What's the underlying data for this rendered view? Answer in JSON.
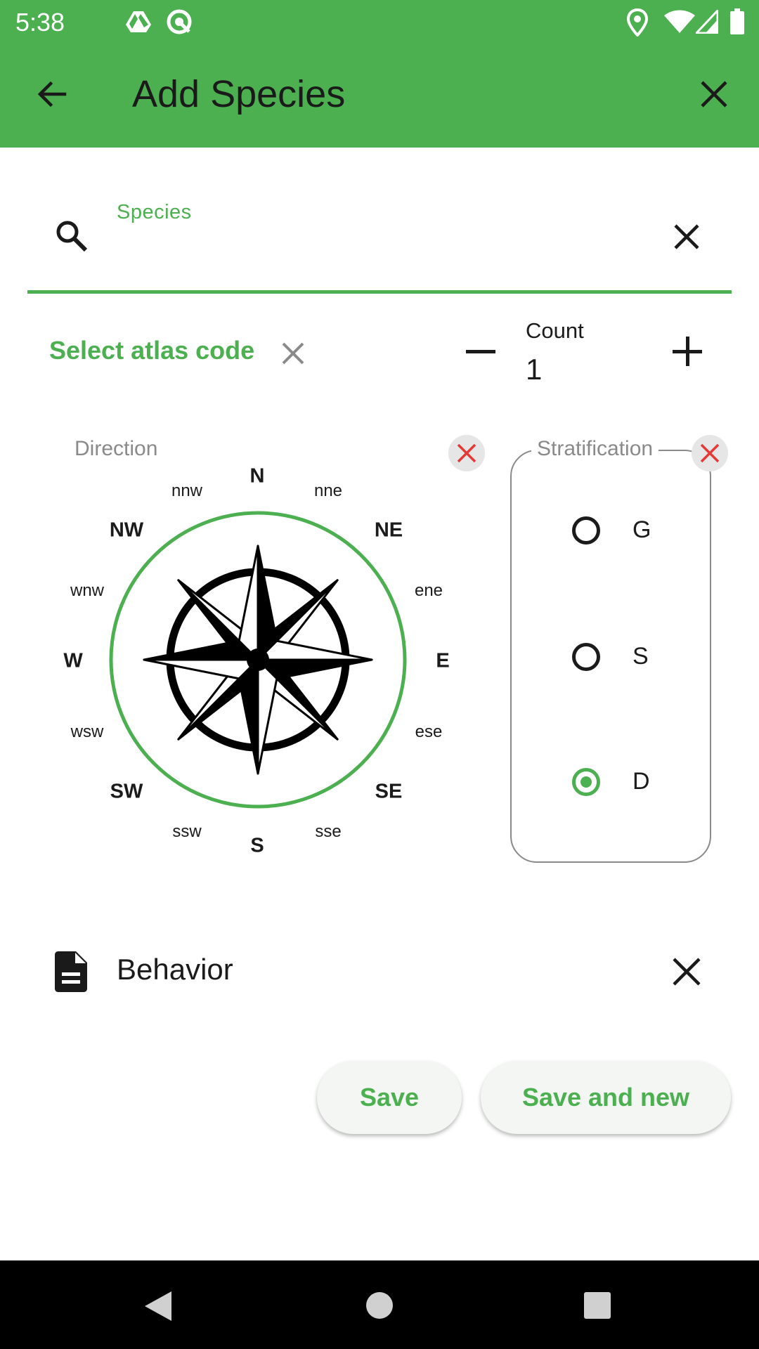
{
  "status_bar": {
    "time": "5:38",
    "left_icons": [
      "drive-icon",
      "sync-icon"
    ],
    "right_icons": [
      "location-icon",
      "wifi-icon",
      "signal-icon",
      "battery-icon"
    ]
  },
  "app_bar": {
    "title": "Add Species",
    "back_icon": "arrow-left-icon",
    "close_icon": "close-icon"
  },
  "species_field": {
    "label": "Species",
    "value": "",
    "placeholder": "",
    "search_icon": "search-icon",
    "clear_icon": "close-icon"
  },
  "atlas_code": {
    "label": "Select atlas code",
    "clear_icon": "close-icon"
  },
  "count": {
    "label": "Count",
    "value": "1",
    "decrement_icon": "minus-icon",
    "increment_icon": "plus-icon"
  },
  "direction": {
    "label": "Direction",
    "clear_icon": "close-icon",
    "compass_points": [
      "N",
      "nne",
      "NE",
      "ene",
      "E",
      "ese",
      "SE",
      "sse",
      "S",
      "ssw",
      "SW",
      "wsw",
      "W",
      "wnw",
      "NW",
      "nnw"
    ]
  },
  "stratification": {
    "label": "Stratification",
    "clear_icon": "close-icon",
    "options": [
      {
        "label": "G",
        "selected": false
      },
      {
        "label": "S",
        "selected": false
      },
      {
        "label": "D",
        "selected": true
      }
    ]
  },
  "behavior": {
    "label": "Behavior",
    "icon": "document-icon",
    "clear_icon": "close-icon"
  },
  "actions": {
    "save_label": "Save",
    "save_and_new_label": "Save and new"
  },
  "colors": {
    "accent": "#4caf50",
    "danger": "#e53935"
  },
  "nav_bar": {
    "icons": [
      "back-triangle-icon",
      "home-circle-icon",
      "recents-square-icon"
    ]
  }
}
